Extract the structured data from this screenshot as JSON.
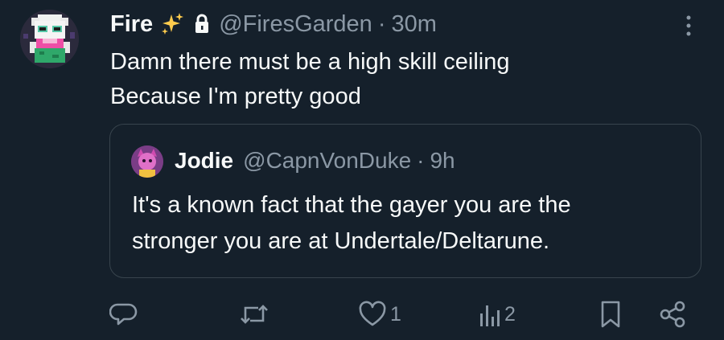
{
  "tweet": {
    "author_name": "Fire",
    "emoji": "sparkles-emoji",
    "handle": "@FiresGarden",
    "separator": "·",
    "time": "30m",
    "text_lines": [
      "Damn there must be a high skill ceiling",
      "Because I'm pretty good"
    ]
  },
  "quoted_tweet": {
    "author_name": "Jodie",
    "handle": "@CapnVonDuke",
    "separator": "·",
    "time": "9h",
    "text_lines": [
      "It's a known fact that the gayer you are the",
      "stronger you are at Undertale/Deltarune."
    ]
  },
  "actions": {
    "reply": {
      "icon": "reply-icon"
    },
    "retweet": {
      "icon": "retweet-icon"
    },
    "like": {
      "icon": "heart-icon",
      "count": "1"
    },
    "views": {
      "icon": "views-icon",
      "count": "2"
    },
    "bookmark": {
      "icon": "bookmark-icon"
    },
    "share": {
      "icon": "share-icon"
    }
  },
  "colors": {
    "background": "#15202b",
    "text_primary": "#f7f9f9",
    "text_secondary": "#8b98a5",
    "border": "#38444d",
    "sparkle": "#ffcc4d"
  }
}
